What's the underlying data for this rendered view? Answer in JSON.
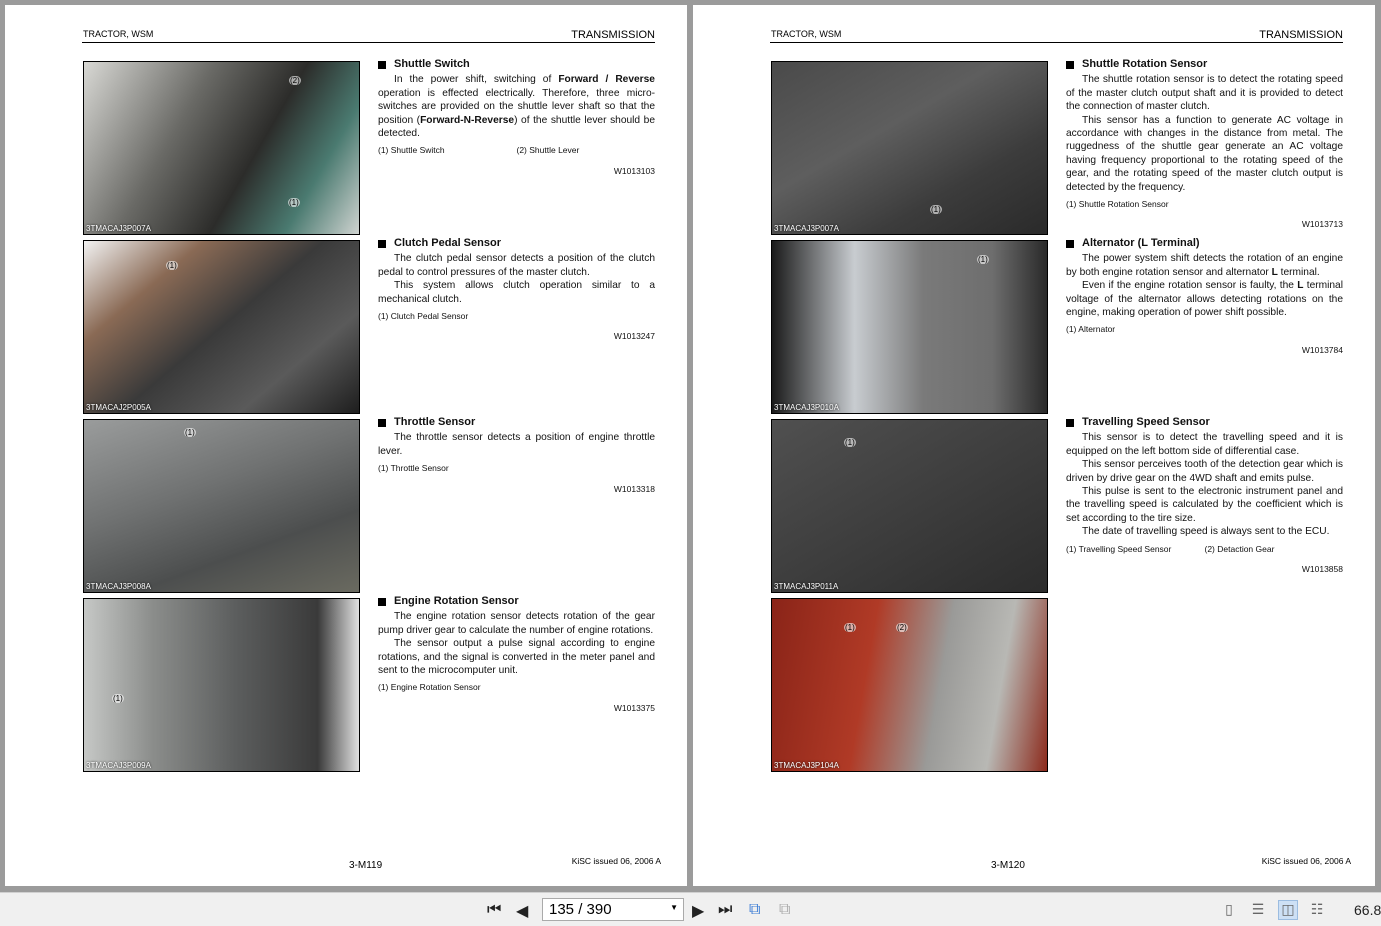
{
  "viewer": {
    "page_input": "135 / 390",
    "zoom": "66.8"
  },
  "pages": [
    {
      "header_left": "TRACTOR, WSM",
      "header_right": "TRANSMISSION",
      "page_number": "3-M119",
      "issue": "KiSC issued 06, 2006 A",
      "photos": [
        {
          "label": "3TMACAJ3P007A",
          "bg": "linear-gradient(120deg,#d8d8d4 0%,#6a6a66 35%,#2c2c2a 60%,#4a7a70 80%,#cfd3d0 100%)",
          "callouts": [
            {
              "t": "(2)"
            },
            {
              "t": "(1)"
            }
          ]
        },
        {
          "label": "3TMACAJ2P005A",
          "bg": "linear-gradient(140deg,#f2f2f2 0%,#8a6a55 25%,#3a3a3a 50%,#5a5a5a 75%,#1e1e1e 100%)",
          "callouts": [
            {
              "t": "(1)"
            }
          ]
        },
        {
          "label": "3TMACAJ3P008A",
          "bg": "linear-gradient(160deg,#9a9c9c 0%,#707272 40%,#4c4e4e 70%,#6a6a60 100%)",
          "callouts": [
            {
              "t": "(1)"
            }
          ]
        },
        {
          "label": "3TMACAJ3P009A",
          "bg": "linear-gradient(90deg,#c6c8c6 0%,#8b8d8b 25%,#5c5e5e 55%,#3a3a3a 85%,#e0e0e0 100%)",
          "callouts": [
            {
              "t": "(1)"
            }
          ]
        }
      ],
      "sections": [
        {
          "title": "Shuttle Switch",
          "paras": [
            [
              {
                "t": "In the power shift, switching of "
              },
              {
                "t": "Forward / Reverse",
                "b": 1
              },
              {
                "t": " operation is effected electrically.  Therefore, three micro-switches are provided on the shuttle lever shaft so that the position ("
              },
              {
                "t": "Forward-N-Reverse",
                "b": 1
              },
              {
                "t": ") of the shuttle lever should be detected."
              }
            ]
          ],
          "captions": [
            "(1)  Shuttle Switch",
            "(2)  Shuttle Lever"
          ],
          "code": "W1013103"
        },
        {
          "title": "Clutch Pedal Sensor",
          "paras": [
            [
              {
                "t": "The clutch pedal sensor detects a position of the clutch pedal to control pressures of the master clutch."
              }
            ],
            [
              {
                "t": "This system allows clutch operation similar to a mechanical clutch."
              }
            ]
          ],
          "captions": [
            "(1)  Clutch Pedal Sensor"
          ],
          "code": "W1013247"
        },
        {
          "title": "Throttle Sensor",
          "paras": [
            [
              {
                "t": "The throttle sensor detects a position of engine throttle lever."
              }
            ]
          ],
          "captions": [
            "(1)  Throttle Sensor"
          ],
          "code": "W1013318"
        },
        {
          "title": "Engine Rotation Sensor",
          "paras": [
            [
              {
                "t": "The engine rotation sensor detects rotation of the gear pump driver gear to calculate the number of engine rotations."
              }
            ],
            [
              {
                "t": "The sensor output a pulse signal according to engine rotations, and the signal is converted in the meter panel and sent to the microcomputer unit."
              }
            ]
          ],
          "captions": [
            "(1)  Engine Rotation Sensor"
          ],
          "code": "W1013375"
        }
      ]
    },
    {
      "header_left": "TRACTOR, WSM",
      "header_right": "TRANSMISSION",
      "page_number": "3-M120",
      "issue": "KiSC issued 06, 2006 A",
      "photos": [
        {
          "label": "3TMACAJ3P007A",
          "bg": "linear-gradient(150deg,#4a4a4a 0%,#5e5e5e 40%,#3c3c3c 70%,#2a2a2a 100%)",
          "callouts": [
            {
              "t": "(1)"
            }
          ]
        },
        {
          "label": "3TMACAJ3P010A",
          "bg": "linear-gradient(90deg,#1a1a1a 0%,#c8ccd0 30%,#7a7a7a 55%,#6e6e6e 80%,#2a2a2a 100%)",
          "callouts": [
            {
              "t": "(1)"
            }
          ]
        },
        {
          "label": "3TMACAJ3P011A",
          "bg": "linear-gradient(150deg,#505050 0%,#3e3e3e 50%,#2c2c2c 100%)",
          "callouts": [
            {
              "t": "(1)"
            }
          ]
        },
        {
          "label": "3TMACAJ3P104A",
          "bg": "linear-gradient(100deg,#8a2418 0%,#b03a26 35%,#9a9a98 60%,#b8b8b4 80%,#8c2a1c 100%)",
          "callouts": [
            {
              "t": "(1)"
            },
            {
              "t": "(2)"
            }
          ]
        }
      ],
      "sections": [
        {
          "title": "Shuttle Rotation Sensor",
          "paras": [
            [
              {
                "t": "The shuttle rotation sensor is to detect the rotating speed of the master clutch output shaft and it is provided to detect the connection of master clutch."
              }
            ],
            [
              {
                "t": "This sensor has a function to generate AC voltage in accordance with changes in the distance from metal. The ruggedness of the shuttle gear generate an AC voltage having frequency proportional to the rotating speed of the gear, and the rotating speed of the master clutch output is detected by the frequency."
              }
            ]
          ],
          "captions": [
            "(1)  Shuttle Rotation Sensor"
          ],
          "code": "W1013713"
        },
        {
          "title": "Alternator (L Terminal)",
          "paras": [
            [
              {
                "t": "The power system shift detects the rotation of an engine by both engine rotation sensor and alternator "
              },
              {
                "t": "L",
                "b": 1
              },
              {
                "t": " terminal."
              }
            ],
            [
              {
                "t": "Even if the engine rotation sensor is faulty, the "
              },
              {
                "t": "L",
                "b": 1
              },
              {
                "t": " terminal voltage of the alternator allows detecting rotations on the engine, making operation of power shift possible."
              }
            ]
          ],
          "captions": [
            "(1)  Alternator"
          ],
          "code": "W1013784"
        },
        {
          "title": "Travelling Speed Sensor",
          "paras": [
            [
              {
                "t": "This sensor is to detect the travelling speed and it is equipped on the left bottom side of differential case."
              }
            ],
            [
              {
                "t": "This sensor perceives tooth of the detection gear which is driven by drive gear on the 4WD shaft and emits pulse."
              }
            ],
            [
              {
                "t": "This pulse is sent to the electronic instrument panel and the travelling speed is calculated by the coefficient which is set according to the tire size."
              }
            ],
            [
              {
                "t": "The date of travelling speed is always sent to the ECU."
              }
            ]
          ],
          "captions": [
            "(1)  Travelling Speed Sensor",
            "(2)  Detaction Gear"
          ],
          "code": "W1013858"
        }
      ]
    }
  ]
}
